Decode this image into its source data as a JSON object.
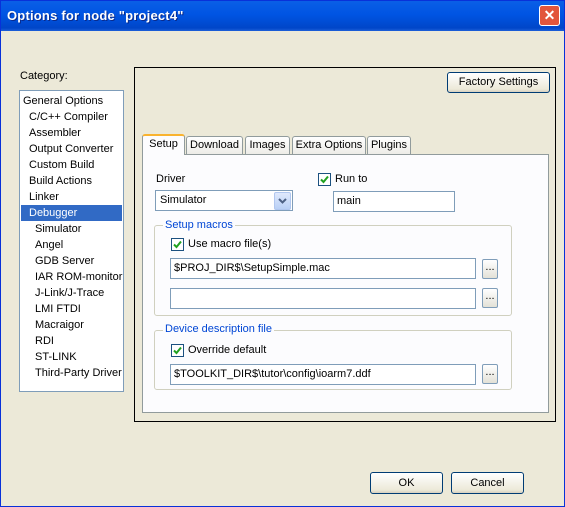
{
  "window": {
    "title": "Options for node \"project4\"",
    "close_glyph": "✕"
  },
  "category": {
    "label": "Category:",
    "items": [
      "General Options",
      "C/C++ Compiler",
      "Assembler",
      "Output Converter",
      "Custom Build",
      "Build Actions",
      "Linker",
      "Debugger",
      "Simulator",
      "Angel",
      "GDB Server",
      "IAR ROM-monitor",
      "J-Link/J-Trace",
      "LMI FTDI",
      "Macraigor",
      "RDI",
      "ST-LINK",
      "Third-Party Driver"
    ],
    "selected": "Debugger"
  },
  "factory_settings_label": "Factory Settings",
  "tabs": [
    "Setup",
    "Download",
    "Images",
    "Extra Options",
    "Plugins"
  ],
  "active_tab": "Setup",
  "setup": {
    "driver_label": "Driver",
    "driver_value": "Simulator",
    "run_to_label": "Run to",
    "run_to_checked": true,
    "run_to_value": "main",
    "macros_group": "Setup macros",
    "use_macro_label": "Use macro file(s)",
    "use_macro_checked": true,
    "macro_file_1": "$PROJ_DIR$\\SetupSimple.mac",
    "macro_file_2": "",
    "browse_label": "...",
    "device_group": "Device description file",
    "override_label": "Override default",
    "override_checked": true,
    "device_file": "$TOOLKIT_DIR$\\tutor\\config\\ioarm7.ddf"
  },
  "ok_label": "OK",
  "cancel_label": "Cancel"
}
